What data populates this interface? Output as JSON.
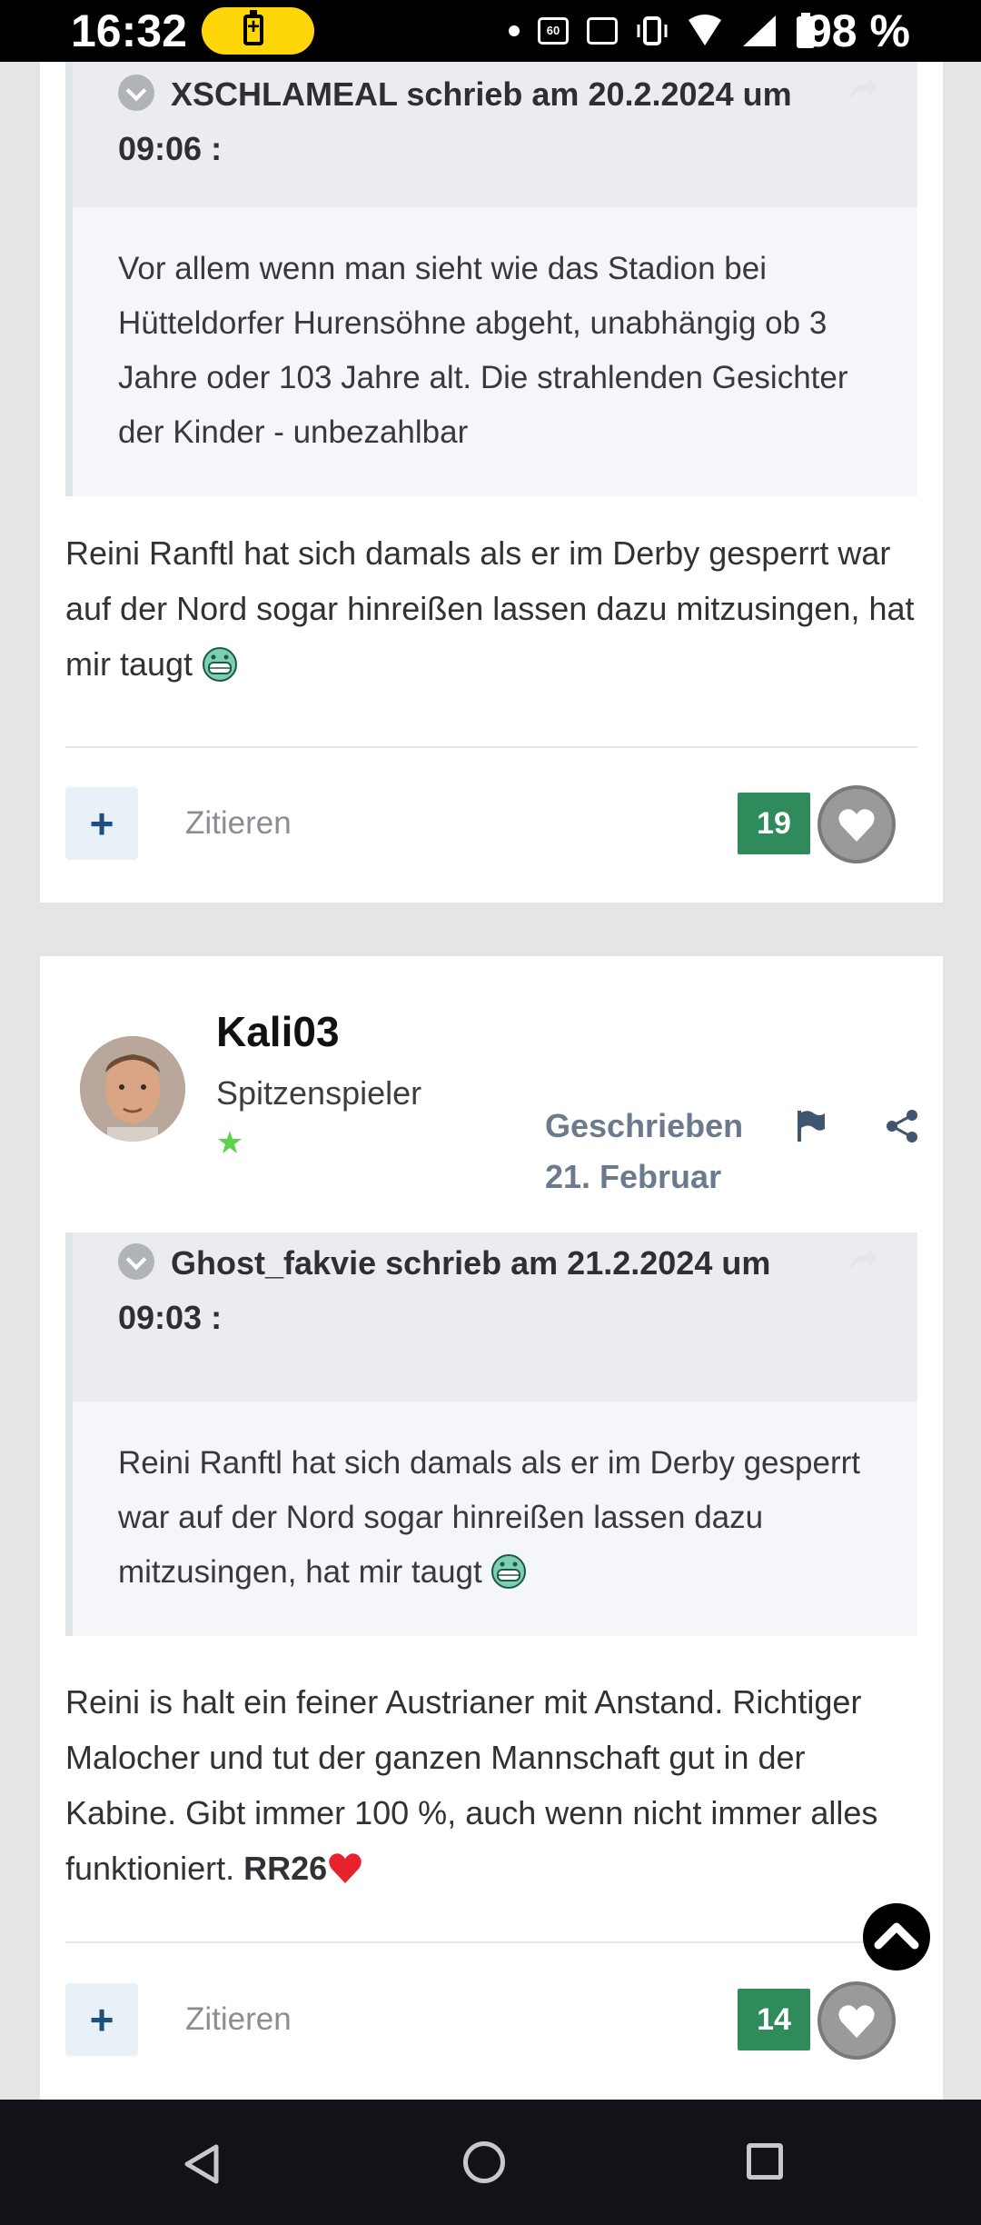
{
  "status_bar": {
    "time": "16:32",
    "battery_percent": "98 %",
    "refresh_rate_label": "60"
  },
  "posts": [
    {
      "quote": {
        "header": "XSCHLAMEAL schrieb am 20.2.2024 um 09:06 :",
        "body": "Vor allem wenn man sieht wie das Stadion bei Hütteldorfer Hurensöhne abgeht, unabhängig ob 3 Jahre oder 103 Jahre alt. Die strahlenden Gesichter der Kinder - unbezahlbar"
      },
      "text": "Reini Ranftl hat sich damals als er im Derby gesperrt war auf der Nord sogar hinreißen lassen dazu mitzusingen, hat mir taugt",
      "text_emoji": "grin-emoji",
      "cite_label": "Zitieren",
      "like_count": "19"
    },
    {
      "author": "Kali03",
      "rank": "Spitzenspieler",
      "posted_label": "Geschrieben",
      "posted_date": "21. Februar",
      "quote": {
        "header": "Ghost_fakvie schrieb am 21.2.2024 um 09:03 :",
        "body": "Reini Ranftl hat sich damals als er im Derby gesperrt war auf der Nord sogar hinreißen lassen dazu mitzusingen, hat mir taugt"
      },
      "text": "Reini is halt ein feiner Austrianer mit Anstand. Richtiger Malocher und tut der ganzen Mannschaft gut in der Kabine. Gibt immer 100 %, auch wenn nicht immer alles funktioniert.",
      "text_bold": "RR26",
      "cite_label": "Zitieren",
      "like_count": "14"
    }
  ],
  "colors": {
    "like_green": "#2f8a5c",
    "accent_blue": "#1f4f7c",
    "rank_star": "#5bd34a"
  }
}
